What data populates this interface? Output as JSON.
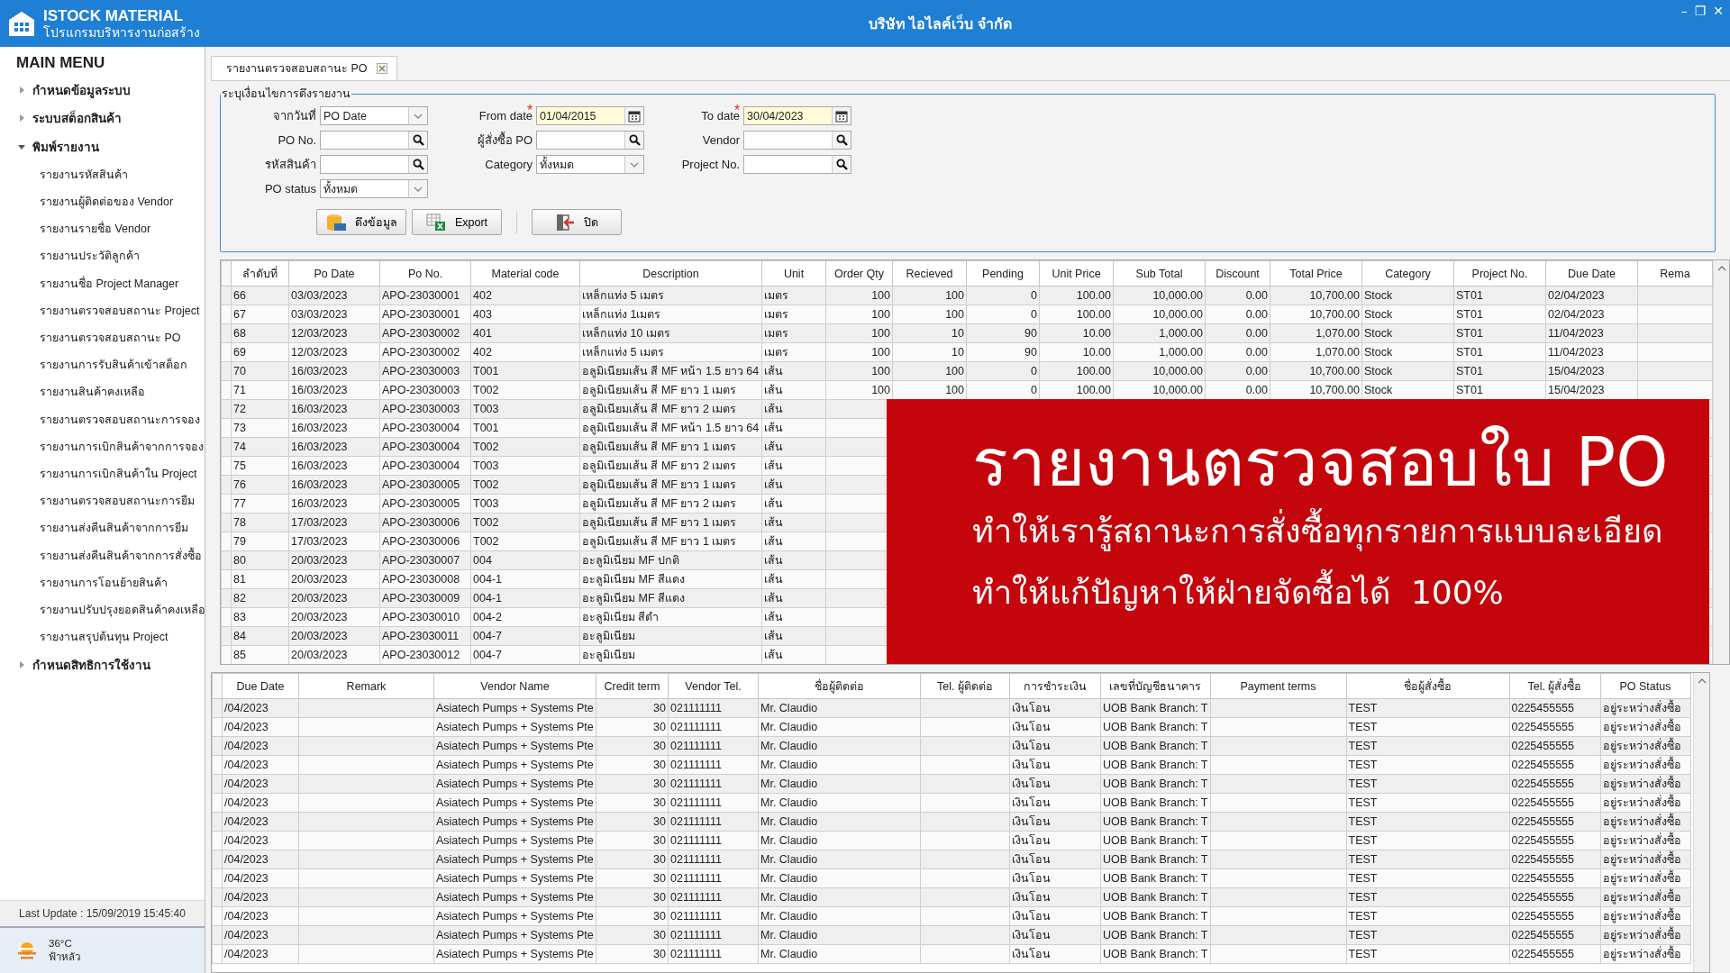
{
  "window": {
    "app_name": "ISTOCK MATERIAL",
    "app_subtitle": "โปรแกรมบริหารงานก่อสร้าง",
    "title": "บริษัท ไอไลค์เว็บ จำกัด",
    "controls": [
      "–",
      "❐",
      "✕"
    ]
  },
  "sidebar": {
    "heading": "MAIN MENU",
    "items": [
      {
        "label": "กำหนดข้อมูลระบบ",
        "expanded": false
      },
      {
        "label": "ระบบสต็อกสินค้า",
        "expanded": false
      },
      {
        "label": "พิมพ์รายงาน",
        "expanded": true,
        "children": [
          {
            "label": "รายงานรหัสสินค้า"
          },
          {
            "label": "รายงานผู้ติดต่อของ Vendor"
          },
          {
            "label": "รายงานรายชื่อ Vendor"
          },
          {
            "label": "รายงานประวัติลูกค้า"
          },
          {
            "label": "รายงานชื่อ Project Manager"
          },
          {
            "label": "รายงานตรวจสอบสถานะ Project"
          },
          {
            "label": "รายงานตรวจสอบสถานะ PO"
          },
          {
            "label": "รายงานการรับสินค้าเข้าสต็อก"
          },
          {
            "label": "รายงานสินค้าคงเหลือ"
          },
          {
            "label": "รายงานตรวจสอบสถานะการจอง"
          },
          {
            "label": "รายงานการเบิกสินค้าจากการจอง"
          },
          {
            "label": "รายงานการเบิกสินค้าใน Project"
          },
          {
            "label": "รายงานตรวจสอบสถานะการยืม"
          },
          {
            "label": "รายงานส่งคืนสินค้าจากการยืม"
          },
          {
            "label": "รายงานส่งคืนสินค้าจากการสั่งซื้อ"
          },
          {
            "label": "รายงานการโอนย้ายสินค้า"
          },
          {
            "label": "รายงานปรับปรุงยอดสินค้าคงเหลือ"
          },
          {
            "label": "รายงานสรุปต้นทุน Project"
          }
        ]
      },
      {
        "label": "กำหนดสิทธิการใช้งาน",
        "expanded": false
      }
    ],
    "last_update": "Last Update : 15/09/2019 15:45:40"
  },
  "weather": {
    "temperature": "36°C",
    "condition": "ฟ้าหลัว"
  },
  "tabs": [
    {
      "label": "รายงานตรวจสอบสถานะ PO",
      "selected": true
    }
  ],
  "form": {
    "legend": "ระบุเงื่อนไขการดึงรายงาน",
    "fields": [
      {
        "label": "จากวันที่",
        "kind": "select",
        "value": "PO Date"
      },
      {
        "label": "From date",
        "kind": "date",
        "value": "01/04/2015",
        "required_mark": "*"
      },
      {
        "label": "To date",
        "kind": "date",
        "value": "30/04/2023",
        "required_mark": "*"
      },
      {
        "label": "PO No.",
        "kind": "search"
      },
      {
        "label": "ผู้สั่งซื้อ PO",
        "kind": "search"
      },
      {
        "label": "Vendor",
        "kind": "search"
      },
      {
        "label": "รหัสสินค้า",
        "kind": "search"
      },
      {
        "label": "Category",
        "kind": "select",
        "value": "ทั้งหมด"
      },
      {
        "label": "Project No.",
        "kind": "search"
      },
      {
        "label": "PO status",
        "kind": "select",
        "value": "ทั้งหมด"
      }
    ],
    "buttons": [
      {
        "label": "ดึงข้อมูล",
        "kind": "sql"
      },
      {
        "label": "Export",
        "kind": "excel"
      },
      {
        "label": "ปิด",
        "kind": "exit"
      }
    ]
  },
  "items_table": {
    "columns": [
      "ลำดับที่",
      "Po Date",
      "Po No.",
      "Material code",
      "Description",
      "Unit",
      "Order Qty",
      "Recieved",
      "Pending",
      "Unit Price",
      "Sub Total",
      "Discount",
      "Total Price",
      "Category",
      "Project No.",
      "Due Date",
      "Rema"
    ],
    "rows": [
      [
        "66",
        "03/03/2023",
        "APO-23030001",
        "402",
        "เหล็กแท่ง 5 เมตร",
        "เมตร",
        "100",
        "100",
        "0",
        "100.00",
        "10,000.00",
        "0.00",
        "10,700.00",
        "Stock",
        "ST01",
        "02/04/2023"
      ],
      [
        "67",
        "03/03/2023",
        "APO-23030001",
        "403",
        "เหล็กแท่ง 1เมตร",
        "เมตร",
        "100",
        "100",
        "0",
        "100.00",
        "10,000.00",
        "0.00",
        "10,700.00",
        "Stock",
        "ST01",
        "02/04/2023"
      ],
      [
        "68",
        "12/03/2023",
        "APO-23030002",
        "401",
        "เหล็กแท่ง 10 เมตร",
        "เมตร",
        "100",
        "10",
        "90",
        "10.00",
        "1,000.00",
        "0.00",
        "1,070.00",
        "Stock",
        "ST01",
        "11/04/2023"
      ],
      [
        "69",
        "12/03/2023",
        "APO-23030002",
        "402",
        "เหล็กแท่ง 5 เมตร",
        "เมตร",
        "100",
        "10",
        "90",
        "10.00",
        "1,000.00",
        "0.00",
        "1,070.00",
        "Stock",
        "ST01",
        "11/04/2023"
      ],
      [
        "70",
        "16/03/2023",
        "APO-23030003",
        "T001",
        "อลูมิเนียมเส้น สี MF หน้า 1.5 ยาว 64",
        "เส้น",
        "100",
        "100",
        "0",
        "100.00",
        "10,000.00",
        "0.00",
        "10,700.00",
        "Stock",
        "ST01",
        "15/04/2023"
      ],
      [
        "71",
        "16/03/2023",
        "APO-23030003",
        "T002",
        "อลูมิเนียมเส้น สี MF ยาว 1 เมตร",
        "เส้น",
        "100",
        "100",
        "0",
        "100.00",
        "10,000.00",
        "0.00",
        "10,700.00",
        "Stock",
        "ST01",
        "15/04/2023"
      ],
      [
        "72",
        "16/03/2023",
        "APO-23030003",
        "T003",
        "อลูมิเนียมเส้น สี MF ยาว 2 เมตร",
        "เส้น"
      ],
      [
        "73",
        "16/03/2023",
        "APO-23030004",
        "T001",
        "อลูมิเนียมเส้น สี MF หน้า 1.5 ยาว 64",
        "เส้น"
      ],
      [
        "74",
        "16/03/2023",
        "APO-23030004",
        "T002",
        "อลูมิเนียมเส้น สี MF ยาว 1 เมตร",
        "เส้น"
      ],
      [
        "75",
        "16/03/2023",
        "APO-23030004",
        "T003",
        "อลูมิเนียมเส้น สี MF ยาว 2 เมตร",
        "เส้น"
      ],
      [
        "76",
        "16/03/2023",
        "APO-23030005",
        "T002",
        "อลูมิเนียมเส้น สี MF ยาว 1 เมตร",
        "เส้น"
      ],
      [
        "77",
        "16/03/2023",
        "APO-23030005",
        "T003",
        "อลูมิเนียมเส้น สี MF ยาว 2 เมตร",
        "เส้น"
      ],
      [
        "78",
        "17/03/2023",
        "APO-23030006",
        "T002",
        "อลูมิเนียมเส้น สี MF ยาว 1 เมตร",
        "เส้น"
      ],
      [
        "79",
        "17/03/2023",
        "APO-23030006",
        "T002",
        "อลูมิเนียมเส้น สี MF ยาว 1 เมตร",
        "เส้น"
      ],
      [
        "80",
        "20/03/2023",
        "APO-23030007",
        "004",
        "อะลูมิเนียม MF ปกติ",
        "เส้น"
      ],
      [
        "81",
        "20/03/2023",
        "APO-23030008",
        "004-1",
        "อะลูมิเนียม MF สีแดง",
        "เส้น"
      ],
      [
        "82",
        "20/03/2023",
        "APO-23030009",
        "004-1",
        "อะลูมิเนียม MF สีแดง",
        "เส้น"
      ],
      [
        "83",
        "20/03/2023",
        "APO-23030010",
        "004-2",
        "อะลูมิเนียม สีดำ",
        "เส้น"
      ],
      [
        "84",
        "20/03/2023",
        "APO-23030011",
        "004-7",
        "อะลูมิเนียม",
        "เส้น"
      ],
      [
        "85",
        "20/03/2023",
        "APO-23030012",
        "004-7",
        "อะลูมิเนียม",
        "เส้น"
      ]
    ]
  },
  "banner": {
    "title": "รายงานตรวจสอบใบ PO",
    "lines": [
      "ทำให้เรารู้สถานะการสั่งซื้อทุกรายการแบบละเอียด",
      "ทำให้แก้ปัญหาให้ฝ่ายจัดซื้อได้  100%"
    ]
  },
  "vendor_table": {
    "columns": [
      "Due Date",
      "Remark",
      "Vendor Name",
      "Credit term",
      "Vendor Tel.",
      "ชื่อผู้ติดต่อ",
      "Tel. ผู้ติดต่อ",
      "การชำระเงิน",
      "เลขที่บัญชีธนาคาร",
      "Payment terms",
      "ชื่อผู้สั่งซื้อ",
      "Tel. ผู้สั่งซื้อ",
      "PO Status"
    ],
    "rows": [
      [
        "/04/2023",
        null,
        "Asiatech Pumps + Systems Pte",
        "30",
        "021111111",
        "Mr. Claudio",
        null,
        "เงินโอน",
        "UOB Bank Branch: T",
        null,
        "TEST",
        "0225455555",
        "อยู่ระหว่างสั่งซื้อ"
      ],
      [
        "/04/2023",
        null,
        "Asiatech Pumps + Systems Pte",
        "30",
        "021111111",
        "Mr. Claudio",
        null,
        "เงินโอน",
        "UOB Bank Branch: T",
        null,
        "TEST",
        "0225455555",
        "อยู่ระหว่างสั่งซื้อ"
      ],
      [
        "/04/2023",
        null,
        "Asiatech Pumps + Systems Pte",
        "30",
        "021111111",
        "Mr. Claudio",
        null,
        "เงินโอน",
        "UOB Bank Branch: T",
        null,
        "TEST",
        "0225455555",
        "อยู่ระหว่างสั่งซื้อ"
      ],
      [
        "/04/2023",
        null,
        "Asiatech Pumps + Systems Pte",
        "30",
        "021111111",
        "Mr. Claudio",
        null,
        "เงินโอน",
        "UOB Bank Branch: T",
        null,
        "TEST",
        "0225455555",
        "อยู่ระหว่างสั่งซื้อ"
      ],
      [
        "/04/2023",
        null,
        "Asiatech Pumps + Systems Pte",
        "30",
        "021111111",
        "Mr. Claudio",
        null,
        "เงินโอน",
        "UOB Bank Branch: T",
        null,
        "TEST",
        "0225455555",
        "อยู่ระหว่างสั่งซื้อ"
      ],
      [
        "/04/2023",
        null,
        "Asiatech Pumps + Systems Pte",
        "30",
        "021111111",
        "Mr. Claudio",
        null,
        "เงินโอน",
        "UOB Bank Branch: T",
        null,
        "TEST",
        "0225455555",
        "อยู่ระหว่างสั่งซื้อ"
      ],
      [
        "/04/2023",
        null,
        "Asiatech Pumps + Systems Pte",
        "30",
        "021111111",
        "Mr. Claudio",
        null,
        "เงินโอน",
        "UOB Bank Branch: T",
        null,
        "TEST",
        "0225455555",
        "อยู่ระหว่างสั่งซื้อ"
      ],
      [
        "/04/2023",
        null,
        "Asiatech Pumps + Systems Pte",
        "30",
        "021111111",
        "Mr. Claudio",
        null,
        "เงินโอน",
        "UOB Bank Branch: T",
        null,
        "TEST",
        "0225455555",
        "อยู่ระหว่างสั่งซื้อ"
      ],
      [
        "/04/2023",
        null,
        "Asiatech Pumps + Systems Pte",
        "30",
        "021111111",
        "Mr. Claudio",
        null,
        "เงินโอน",
        "UOB Bank Branch: T",
        null,
        "TEST",
        "0225455555",
        "อยู่ระหว่างสั่งซื้อ"
      ],
      [
        "/04/2023",
        null,
        "Asiatech Pumps + Systems Pte",
        "30",
        "021111111",
        "Mr. Claudio",
        null,
        "เงินโอน",
        "UOB Bank Branch: T",
        null,
        "TEST",
        "0225455555",
        "อยู่ระหว่างสั่งซื้อ"
      ],
      [
        "/04/2023",
        null,
        "Asiatech Pumps + Systems Pte",
        "30",
        "021111111",
        "Mr. Claudio",
        null,
        "เงินโอน",
        "UOB Bank Branch: T",
        null,
        "TEST",
        "0225455555",
        "อยู่ระหว่างสั่งซื้อ"
      ],
      [
        "/04/2023",
        null,
        "Asiatech Pumps + Systems Pte",
        "30",
        "021111111",
        "Mr. Claudio",
        null,
        "เงินโอน",
        "UOB Bank Branch: T",
        null,
        "TEST",
        "0225455555",
        "อยู่ระหว่างสั่งซื้อ"
      ],
      [
        "/04/2023",
        null,
        "Asiatech Pumps + Systems Pte",
        "30",
        "021111111",
        "Mr. Claudio",
        null,
        "เงินโอน",
        "UOB Bank Branch: T",
        null,
        "TEST",
        "0225455555",
        "อยู่ระหว่างสั่งซื้อ"
      ],
      [
        "/04/2023",
        null,
        "Asiatech Pumps + Systems Pte",
        "30",
        "021111111",
        "Mr. Claudio",
        null,
        "เงินโอน",
        "UOB Bank Branch: T",
        null,
        "TEST",
        "0225455555",
        "อยู่ระหว่างสั่งซื้อ"
      ]
    ]
  }
}
